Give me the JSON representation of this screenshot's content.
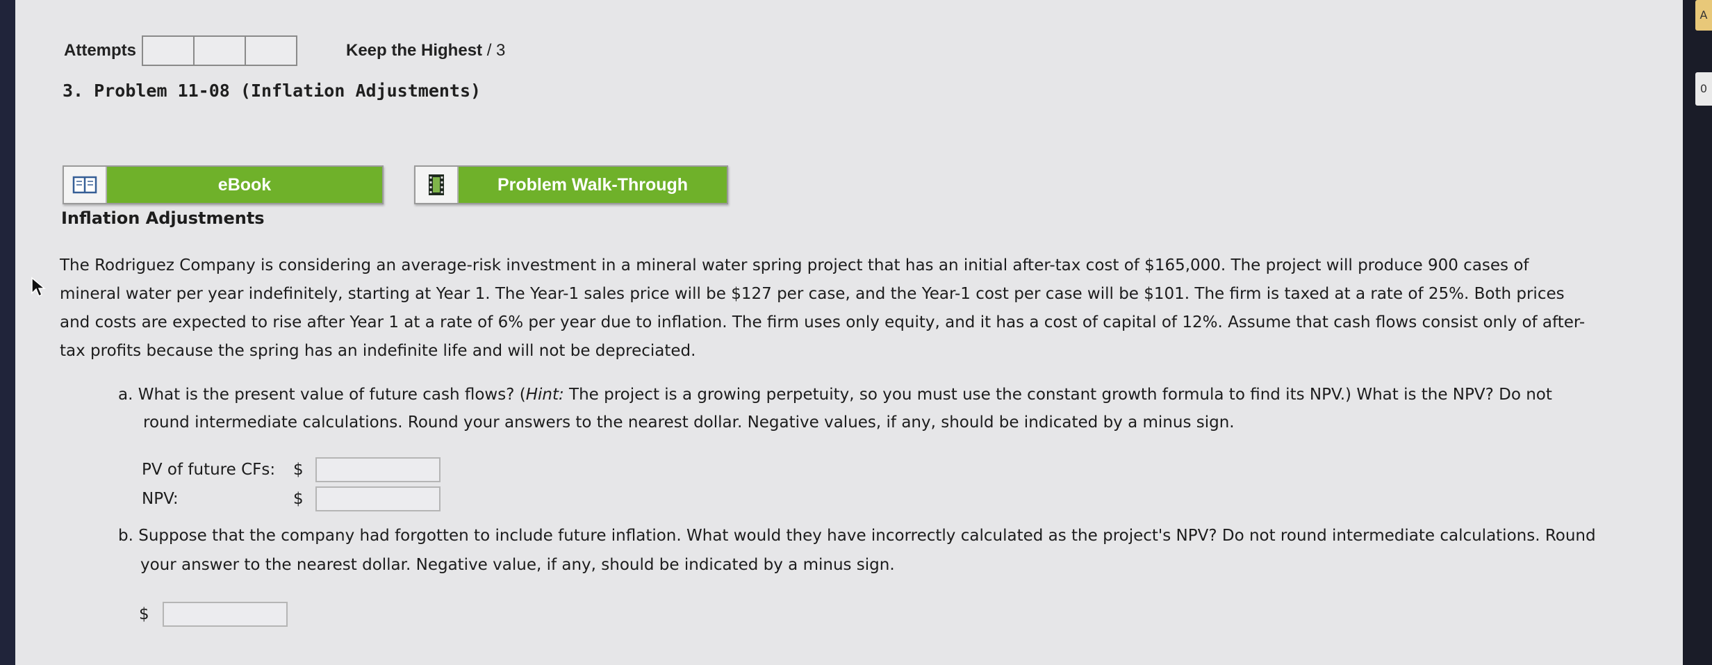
{
  "attempts": {
    "label": "Attempts",
    "boxes": [
      "",
      "",
      ""
    ]
  },
  "keep": {
    "label": "Keep the Highest",
    "suffix": " / 3"
  },
  "problem": {
    "number": "3.",
    "title": "Problem 11-08 (Inflation Adjustments)"
  },
  "toolbar": {
    "ebook_label": "eBook",
    "walkthrough_label": "Problem Walk-Through",
    "ebook_icon": "book-icon",
    "walkthrough_icon": "film-icon",
    "accent": "#6fb12a"
  },
  "section_heading": "Inflation Adjustments",
  "paragraph_lines": [
    "The Rodriguez Company is considering an average-risk investment in a mineral water spring project that has an initial after-tax cost of $165,000. The project will produce 900 cases of",
    "mineral water per year indefinitely, starting at Year 1. The Year-1 sales price will be $127 per case, and the Year-1 cost per case will be $101. The firm is taxed at a rate of 25%. Both prices",
    "and costs are expected to rise after Year 1 at a rate of 6% per year due to inflation. The firm uses only equity, and it has a cost of capital of 12%. Assume that cash flows consist only of after-",
    "tax profits because the spring has an indefinite life and will not be depreciated."
  ],
  "question_a": {
    "line1_prefix": "a. What is the present value of future cash flows? (",
    "hint_label": "Hint:",
    "line1_suffix": " The project is a growing perpetuity, so you must use the constant growth formula to find its NPV.) What is the NPV? Do not",
    "line2": "round intermediate calculations. Round your answers to the nearest dollar. Negative values, if any, should be indicated by a minus sign.",
    "fields": [
      {
        "label": "PV of future CFs:",
        "currency": "$",
        "value": ""
      },
      {
        "label": "NPV:",
        "currency": "$",
        "value": ""
      }
    ]
  },
  "question_b": {
    "line1": "b. Suppose that the company had forgotten to include future inflation. What would they have incorrectly calculated as the project's NPV? Do not round intermediate calculations. Round",
    "line2": "your answer to the nearest dollar. Negative value, if any, should be indicated by a minus sign.",
    "currency": "$",
    "value": ""
  },
  "gutter_chips": [
    "A",
    "0"
  ]
}
